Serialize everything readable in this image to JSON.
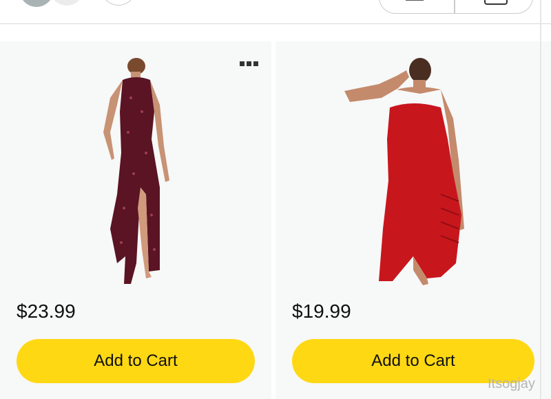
{
  "products": [
    {
      "price": "$23.99",
      "button_label": "Add to Cart",
      "image_desc": "burgundy-sequin-dress-image",
      "dress_color": "#5a1424"
    },
    {
      "price": "$19.99",
      "button_label": "Add to Cart",
      "image_desc": "red-lace-up-dress-image",
      "dress_color": "#c8161d"
    }
  ],
  "watermark": "Itsogjay"
}
